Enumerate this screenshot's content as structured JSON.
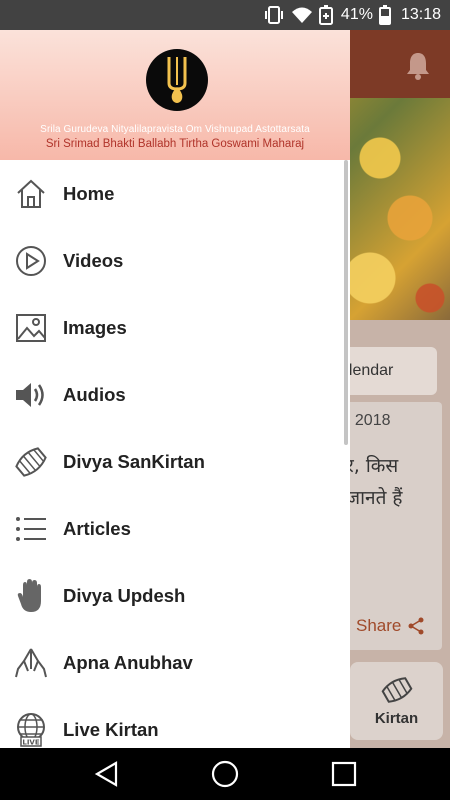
{
  "status_bar": {
    "battery_percent": "41%",
    "time": "13:18",
    "icons": [
      "vibrate-icon",
      "wifi-icon",
      "battery-saver-icon",
      "battery-icon"
    ]
  },
  "background": {
    "calendar_label": "alendar",
    "date_text": ", 2018",
    "hindi_line1": "र, किस",
    "hindi_line2": "जानते हैं",
    "share_label": "Share",
    "kirtan_label": "Kirtan",
    "colors": {
      "topbar": "#7d3a26",
      "share": "#a04a2a"
    }
  },
  "drawer": {
    "header": {
      "line1": "Srila Gurudeva Nityalilapravista Om Vishnupad Astottarsata",
      "line2": "Sri Srimad Bhakti Ballabh Tirtha Goswami Maharaj",
      "colors": {
        "top": "#fbe2da",
        "bottom": "#f7b8a9",
        "line2": "#b0342a"
      }
    },
    "items": [
      {
        "label": "Home",
        "icon": "home-icon"
      },
      {
        "label": "Videos",
        "icon": "play-circle-icon"
      },
      {
        "label": "Images",
        "icon": "image-icon"
      },
      {
        "label": "Audios",
        "icon": "speaker-icon"
      },
      {
        "label": "Divya SanKirtan",
        "icon": "mridanga-drum-icon"
      },
      {
        "label": "Articles",
        "icon": "list-icon"
      },
      {
        "label": "Divya Updesh",
        "icon": "raised-hand-icon"
      },
      {
        "label": "Apna Anubhav",
        "icon": "praying-hands-icon"
      },
      {
        "label": "Live Kirtan",
        "icon": "live-globe-icon"
      }
    ]
  },
  "nav_bar": {
    "buttons": [
      "back-icon",
      "home-circle-icon",
      "recents-icon"
    ]
  }
}
